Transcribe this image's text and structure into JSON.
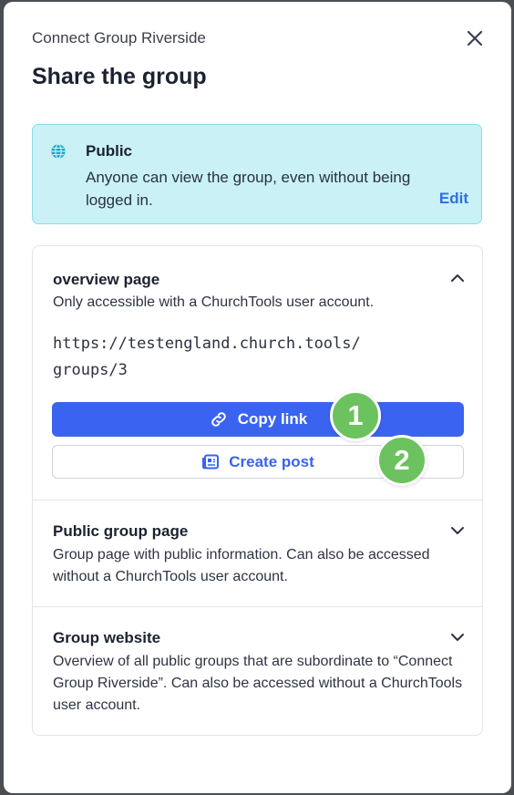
{
  "dialog": {
    "group_name": "Connect Group Riverside",
    "title": "Share the group"
  },
  "visibility": {
    "title": "Public",
    "description": "Anyone can view the group, even without being logged in.",
    "edit_label": "Edit"
  },
  "sections": [
    {
      "title": "overview page",
      "description": "Only accessible with a ChurchTools user account.",
      "url_line1": "https://testengland.church.tools/",
      "url_line2": "groups/3",
      "copy_label": "Copy link",
      "post_label": "Create post",
      "expanded": true
    },
    {
      "title": "Public group page",
      "description": "Group page with public information. Can also be accessed without a ChurchTools user account.",
      "expanded": false
    },
    {
      "title": "Group website",
      "description": "Overview of all public groups that are subordinate to “Connect Group Riverside”. Can also be accessed without a ChurchTools user account.",
      "expanded": false
    }
  ],
  "markers": [
    "1",
    "2"
  ],
  "colors": {
    "primary": "#3a63ef",
    "public_bg": "#c9f1f6",
    "marker": "#6cc25f"
  }
}
